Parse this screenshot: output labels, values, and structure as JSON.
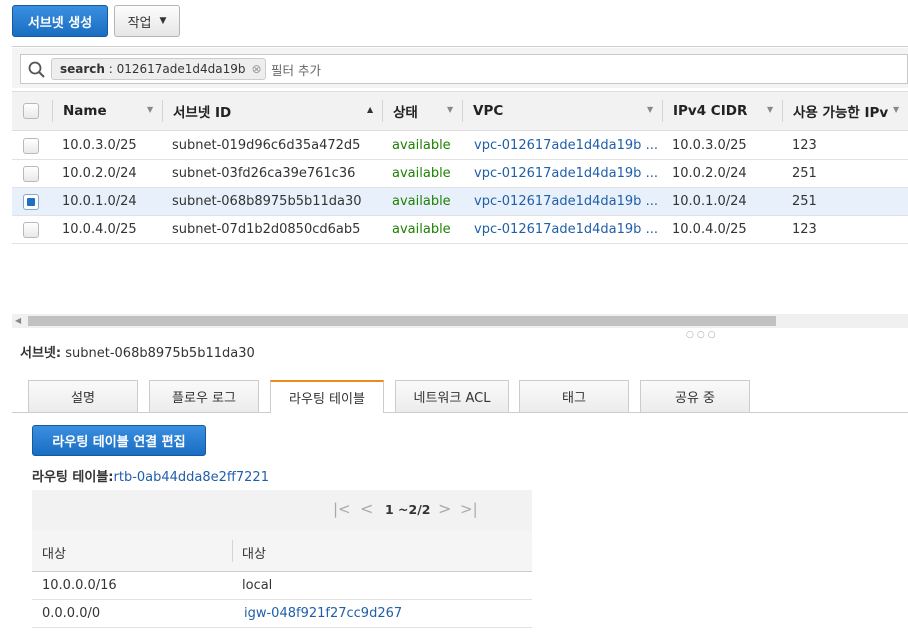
{
  "toolbar": {
    "create_subnet": "서브넷 생성",
    "actions": "작업",
    "actions_caret": "▼"
  },
  "filter": {
    "token_key": "search",
    "token_sep": " : ",
    "token_value": "012617ade1d4da19b",
    "token_remove": "⊗",
    "placeholder": "필터 추가"
  },
  "columns": [
    {
      "label": "Name",
      "arrow": "▼"
    },
    {
      "label": "서브넷 ID",
      "arrow": "▲"
    },
    {
      "label": "상태",
      "arrow": "▼"
    },
    {
      "label": "VPC",
      "arrow": "▼"
    },
    {
      "label": "IPv4 CIDR",
      "arrow": "▼"
    },
    {
      "label": "사용 가능한 IPv",
      "arrow": "▼"
    }
  ],
  "rows": [
    {
      "name": "10.0.3.0/25",
      "subnet_id": "subnet-019d96c6d35a472d5",
      "state": "available",
      "vpc": "vpc-012617ade1d4da19b ...",
      "cidr": "10.0.3.0/25",
      "available_ips": "123",
      "selected": false
    },
    {
      "name": "10.0.2.0/24",
      "subnet_id": "subnet-03fd26ca39e761c36",
      "state": "available",
      "vpc": "vpc-012617ade1d4da19b ...",
      "cidr": "10.0.2.0/24",
      "available_ips": "251",
      "selected": false
    },
    {
      "name": "10.0.1.0/24",
      "subnet_id": "subnet-068b8975b5b11da30",
      "state": "available",
      "vpc": "vpc-012617ade1d4da19b ...",
      "cidr": "10.0.1.0/24",
      "available_ips": "251",
      "selected": true
    },
    {
      "name": "10.0.4.0/25",
      "subnet_id": "subnet-07d1b2d0850cd6ab5",
      "state": "available",
      "vpc": "vpc-012617ade1d4da19b ...",
      "cidr": "10.0.4.0/25",
      "available_ips": "123",
      "selected": false
    }
  ],
  "detail": {
    "label": "서브넷:",
    "subnet_id": "subnet-068b8975b5b11da30",
    "tabs": [
      "설명",
      "플로우 로그",
      "라우팅 테이블",
      "네트워크 ACL",
      "태그",
      "공유 중"
    ],
    "active_tab": "라우팅 테이블"
  },
  "route_table": {
    "edit_button": "라우팅 테이블 연결 편집",
    "label": "라우팅 테이블:",
    "id": "rtb-0ab44dda8e2ff7221",
    "pagination": "1 ~2/2",
    "headers": [
      "대상",
      "대상"
    ],
    "routes": [
      {
        "destination": "10.0.0.0/16",
        "target": "local",
        "target_is_link": false
      },
      {
        "destination": "0.0.0.0/0",
        "target": "igw-048f921f27cc9d267",
        "target_is_link": true
      }
    ]
  },
  "colors": {
    "primary": "#1f78d1",
    "available": "#1d8102",
    "link": "#1f5fa8",
    "active_tab": "#e88c1a"
  }
}
